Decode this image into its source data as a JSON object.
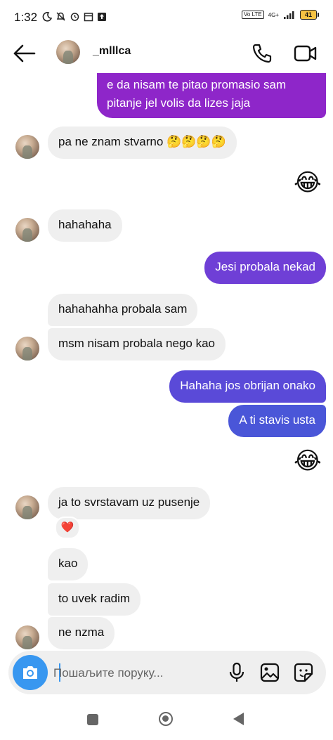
{
  "status_bar": {
    "time": "1:32",
    "network_label": "4G+",
    "lte_label": "Vo LTE",
    "battery_level": "41"
  },
  "header": {
    "username": "_mlllca"
  },
  "messages": [
    {
      "from": "me",
      "text": "e da nisam te pitao promasio sam"
    },
    {
      "from": "me",
      "text": "pitanje jel volis da lizes jaja"
    },
    {
      "from": "them",
      "text": "pa ne znam stvarno 🤔🤔🤔🤔"
    },
    {
      "from": "me",
      "text": "😂"
    },
    {
      "from": "them",
      "text": "hahahaha"
    },
    {
      "from": "me",
      "text": "Jesi probala nekad"
    },
    {
      "from": "them",
      "text": "hahahahha probala sam"
    },
    {
      "from": "them",
      "text": "msm nisam probala nego kao"
    },
    {
      "from": "me",
      "text": "Hahaha jos obrijan onako"
    },
    {
      "from": "me",
      "text": "A ti stavis usta"
    },
    {
      "from": "me",
      "text": "😂"
    },
    {
      "from": "them",
      "text": "ja to svrstavam uz pusenje",
      "reaction": "❤️"
    },
    {
      "from": "them",
      "text": "kao"
    },
    {
      "from": "them",
      "text": "to uvek radim"
    },
    {
      "from": "them",
      "text": "ne nzma"
    }
  ],
  "composer": {
    "placeholder": "Пошаљите поруку...",
    "value": ""
  },
  "icons": {
    "back": "arrow-left-icon",
    "call": "phone-icon",
    "video": "video-camera-icon",
    "camera": "camera-icon",
    "mic": "microphone-icon",
    "gallery": "image-icon",
    "sticker": "sticker-icon"
  },
  "colors": {
    "outgoing_top": "#8e26c9",
    "outgoing_mid": "#6f3fd6",
    "outgoing_bottom": "#4a56d8",
    "incoming": "#efefef",
    "accent": "#3897f0"
  }
}
